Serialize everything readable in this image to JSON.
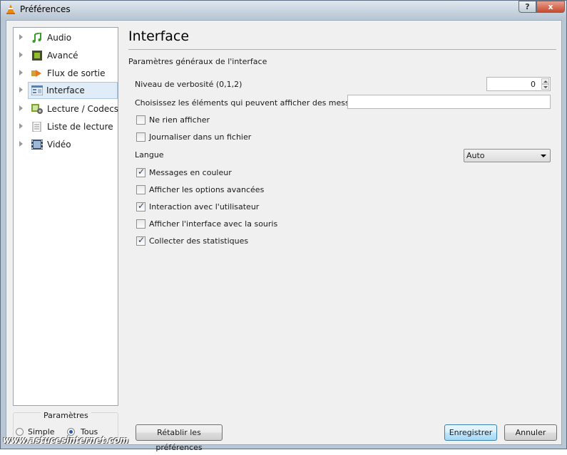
{
  "window": {
    "title": "Préférences",
    "help_label": "?",
    "close_label": "x"
  },
  "sidebar": {
    "items": [
      {
        "label": "Audio",
        "icon": "music-note-icon"
      },
      {
        "label": "Avancé",
        "icon": "chip-icon"
      },
      {
        "label": "Flux de sortie",
        "icon": "stream-output-icon"
      },
      {
        "label": "Interface",
        "icon": "interface-icon",
        "selected": true
      },
      {
        "label": "Lecture / Codecs",
        "icon": "codecs-icon"
      },
      {
        "label": "Liste de lecture",
        "icon": "playlist-icon"
      },
      {
        "label": "Vidéo",
        "icon": "film-icon"
      }
    ]
  },
  "parametres": {
    "title": "Paramètres",
    "simple_label": "Simple",
    "tous_label": "Tous",
    "selected": "Tous"
  },
  "main": {
    "title": "Interface",
    "subtitle": "Paramètres généraux de l'interface",
    "verbosity_label": "Niveau de verbosité (0,1,2)",
    "verbosity_value": "0",
    "messages_label": "Choisissez les éléments qui peuvent afficher des messages",
    "messages_value": "",
    "checkboxes": [
      {
        "label": "Ne rien afficher",
        "checked": false
      },
      {
        "label": "Journaliser dans un fichier",
        "checked": false
      },
      {
        "label": "Messages en couleur",
        "checked": true
      },
      {
        "label": "Afficher les options avancées",
        "checked": false
      },
      {
        "label": "Interaction avec l'utilisateur",
        "checked": true
      },
      {
        "label": "Afficher l'interface avec la souris",
        "checked": false
      },
      {
        "label": "Collecter des statistiques",
        "checked": true
      }
    ],
    "langue_label": "Langue",
    "langue_value": "Auto"
  },
  "buttons": {
    "reset": "Rétablir les préférences",
    "save": "Enregistrer",
    "cancel": "Annuler"
  },
  "watermark": "www.astucesinternet.com"
}
